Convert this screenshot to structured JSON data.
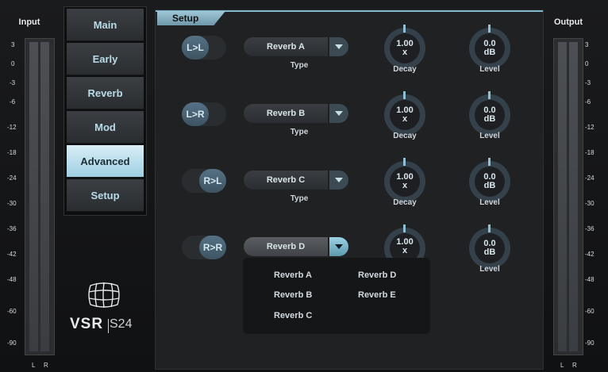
{
  "meters": {
    "input_title": "Input",
    "output_title": "Output",
    "scale": [
      "3",
      "0",
      "-3",
      "-6",
      "-12",
      "-18",
      "-24",
      "-30",
      "-36",
      "-42",
      "-48",
      "-60",
      "-90"
    ],
    "left_label": "L",
    "right_label": "R"
  },
  "tabs": [
    {
      "label": "Main",
      "active": false
    },
    {
      "label": "Early",
      "active": false
    },
    {
      "label": "Reverb",
      "active": false
    },
    {
      "label": "Mod",
      "active": false
    },
    {
      "label": "Advanced",
      "active": true
    },
    {
      "label": "Setup",
      "active": false
    }
  ],
  "logo": {
    "brand": "VSR",
    "model": "S24"
  },
  "setup": {
    "header": "Setup",
    "rows": [
      {
        "route": "L>L",
        "type": "Reverb A",
        "type_label": "Type",
        "decay": "1.00",
        "decay_unit": "x",
        "decay_label": "Decay",
        "level": "0.0",
        "level_unit": "dB",
        "level_label": "Level"
      },
      {
        "route": "L>R",
        "type": "Reverb B",
        "type_label": "Type",
        "decay": "1.00",
        "decay_unit": "x",
        "decay_label": "Decay",
        "level": "0.0",
        "level_unit": "dB",
        "level_label": "Level"
      },
      {
        "route": "R>L",
        "type": "Reverb C",
        "type_label": "Type",
        "decay": "1.00",
        "decay_unit": "x",
        "decay_label": "Decay",
        "level": "0.0",
        "level_unit": "dB",
        "level_label": "Level"
      },
      {
        "route": "R>R",
        "type": "Reverb D",
        "decay": "1.00",
        "decay_unit": "x",
        "level": "0.0",
        "level_unit": "dB",
        "level_label": "Level"
      }
    ],
    "dropdown_options": [
      "Reverb A",
      "Reverb B",
      "Reverb C",
      "Reverb D",
      "Reverb E"
    ]
  },
  "colors": {
    "accent": "#9fcfe2",
    "panel": "#202123",
    "knob": "#34414a"
  }
}
